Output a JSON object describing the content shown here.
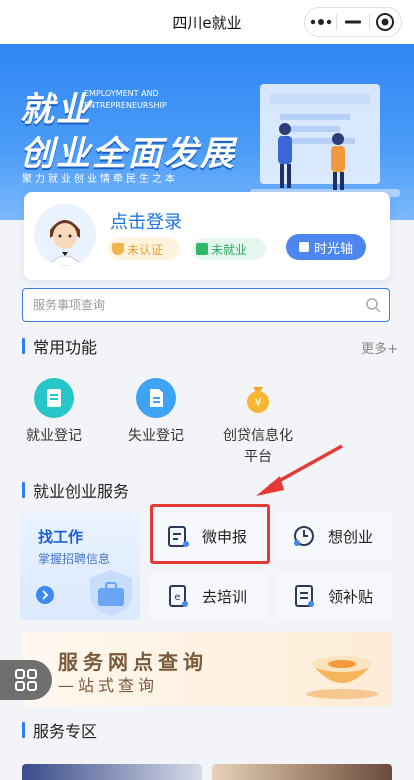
{
  "app": {
    "title": "四川e就业"
  },
  "capsule": {
    "more_icon": "more-dots-icon",
    "minimize_icon": "minus-icon",
    "close_icon": "target-icon"
  },
  "banner": {
    "title_line1": "就业",
    "title_line2": "创业全面发展",
    "english_line1": "EMPLOYMENT AND",
    "english_line2": "ENTREPRENEURSHIP",
    "slogan": "聚力就业创业情牵民生之本"
  },
  "login": {
    "title": "点击登录",
    "status_auth": "未认证",
    "status_job": "未就业",
    "timeline_button": "时光轴"
  },
  "search": {
    "placeholder": "服务事项查询"
  },
  "common": {
    "heading": "常用功能",
    "more": "更多+",
    "items": [
      {
        "label": "就业登记",
        "icon": "document-icon",
        "color": "#26c6c9"
      },
      {
        "label": "失业登记",
        "icon": "file-icon",
        "color": "#3ea3f5"
      },
      {
        "label": "创贷信息化平台",
        "label_line1": "创贷信息化",
        "label_line2": "平台",
        "icon": "money-bag-icon",
        "color": "#f5a623"
      }
    ]
  },
  "services": {
    "heading": "就业创业服务",
    "find_job": {
      "title": "找工作",
      "subtitle": "掌握招聘信息"
    },
    "items": [
      {
        "label": "微申报",
        "icon": "apply-form-icon"
      },
      {
        "label": "想创业",
        "icon": "startup-clock-icon"
      },
      {
        "label": "去培训",
        "icon": "training-book-icon"
      },
      {
        "label": "领补贴",
        "icon": "subsidy-icon"
      }
    ]
  },
  "outlet": {
    "title": "服务网点查询",
    "subtitle": "—站式查询"
  },
  "zone": {
    "heading": "服务专区"
  },
  "colors": {
    "accent": "#2f7cf0",
    "highlight": "#e53935"
  }
}
